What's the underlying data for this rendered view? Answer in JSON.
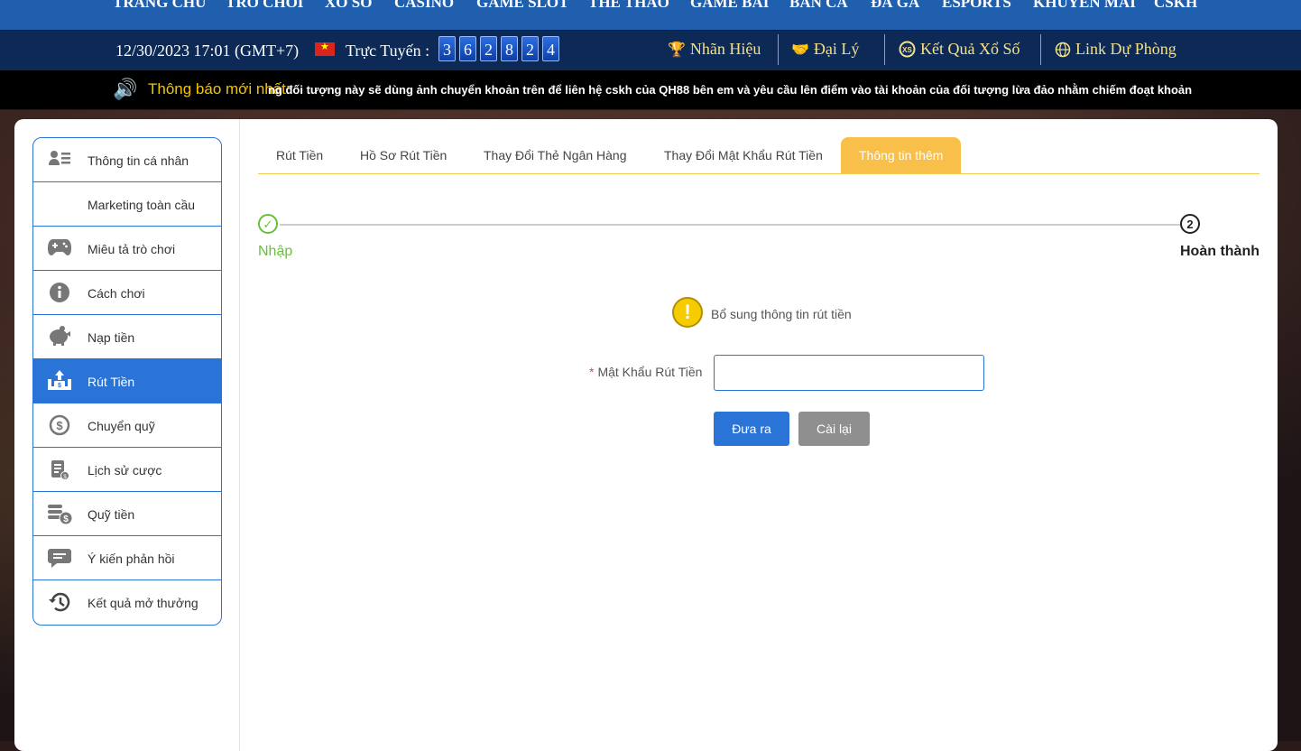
{
  "nav": {
    "items": [
      "TRANG CHỦ",
      "TRÒ CHƠI",
      "XỔ SỐ",
      "CASINO",
      "GAME SLOT",
      "THỂ THAO",
      "GAME BÀI",
      "BẮN CÁ",
      "ĐÁ GÀ",
      "ESPORTS",
      "KHUYẾN MÃI",
      "CSKH"
    ]
  },
  "info": {
    "datetime": "12/30/2023 17:01 (GMT+7)",
    "online_label": "Trực Tuyến :",
    "online_digits": [
      "3",
      "6",
      "2",
      "8",
      "2",
      "4"
    ],
    "links": [
      "Nhãn Hiệu",
      "Đại Lý",
      "Kết Quả Xổ Số",
      "Link Dự Phòng"
    ]
  },
  "ticker": {
    "label": "Thông báo mới nhất:",
    "message": "ng đối tượng này sẽ dùng ảnh chuyển khoản trên để liên hệ cskh của QH88 bên em và yêu cầu lên điểm vào tài khoản của đối tượng lừa đảo nhằm chiếm đoạt khoản"
  },
  "sidebar": {
    "items": [
      {
        "label": "Thông tin cá nhân",
        "icon": "profile-icon"
      },
      {
        "label": "Marketing toàn cầu",
        "icon": ""
      },
      {
        "label": "Miêu tả trò chơi",
        "icon": "gamepad-icon"
      },
      {
        "label": "Cách chơi",
        "icon": "info-icon"
      },
      {
        "label": "Nạp tiền",
        "icon": "piggy-bank-icon"
      },
      {
        "label": "Rút Tiền",
        "icon": "withdraw-icon"
      },
      {
        "label": "Chuyển quỹ",
        "icon": "transfer-icon"
      },
      {
        "label": "Lịch sử cược",
        "icon": "history-doc-icon"
      },
      {
        "label": "Quỹ tiền",
        "icon": "coins-icon"
      },
      {
        "label": "Ý kiến phản hồi",
        "icon": "chat-icon"
      },
      {
        "label": "Kết quả mở thưởng",
        "icon": "clock-history-icon"
      }
    ],
    "active_index": 5
  },
  "tabs": [
    "Rút Tiền",
    "Hồ Sơ Rút Tiền",
    "Thay Đổi Thẻ Ngân Hàng",
    "Thay Đổi Mật Khẩu Rút Tiền",
    "Thông tin thêm"
  ],
  "stepper": {
    "step1": "Nhập",
    "step2_number": "2",
    "step2": "Hoàn thành"
  },
  "form": {
    "notice": "Bổ sung thông tin rút tiền",
    "required_mark": "*",
    "password_label": "Mật Khẩu Rút Tiền",
    "password_value": "",
    "submit_label": "Đưa ra",
    "reset_label": "Cài lại"
  },
  "colors": {
    "nav": "#1f5fae",
    "accent": "#2a74d8",
    "tab_active": "#f8bf4a",
    "success": "#67c23a",
    "link_gold": "#f5e08a"
  }
}
